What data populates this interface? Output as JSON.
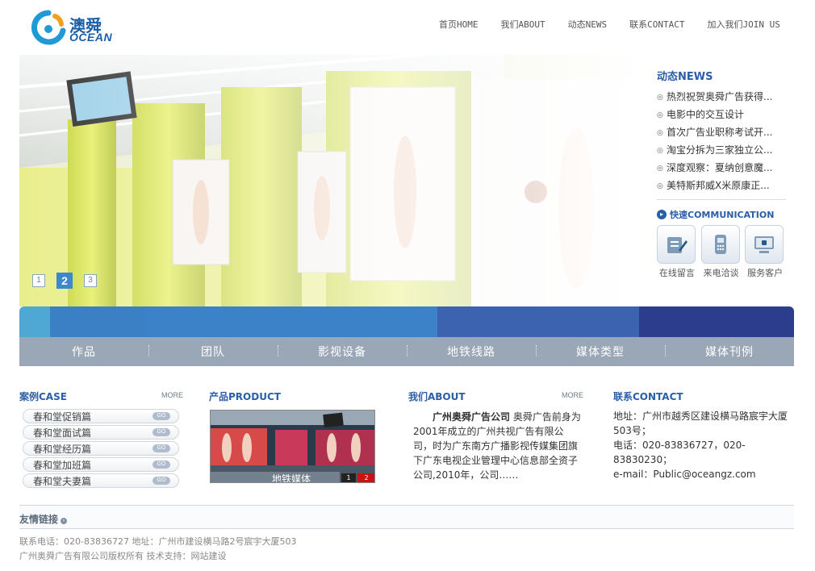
{
  "brand": {
    "logo_cn": "澳舜",
    "logo_en": "OCEAN"
  },
  "nav": {
    "items": [
      {
        "label": "首页HOME"
      },
      {
        "label": "我们ABOUT"
      },
      {
        "label": "动态NEWS"
      },
      {
        "label": "联系CONTACT"
      },
      {
        "label": "加入我们JOIN US"
      }
    ]
  },
  "banner": {
    "dots": [
      "1",
      "2",
      "3"
    ],
    "active_dot": "2",
    "icon": "subway-billboard-photo"
  },
  "news": {
    "title": "动态NEWS",
    "items": [
      "热烈祝贺奥舜广告获得...",
      "电影中的交互设计",
      "首次广告业职称考试开...",
      "淘宝分拆为三家独立公...",
      "深度观察：夏纳创意魔...",
      "美特斯邦威X米原康正..."
    ]
  },
  "quick": {
    "title": "快速COMMUNICATION",
    "items": [
      {
        "label": "在线留言",
        "icon": "message-icon"
      },
      {
        "label": "来电洽谈",
        "icon": "phone-icon"
      },
      {
        "label": "服务客户",
        "icon": "computer-icon"
      }
    ]
  },
  "strip_colors": [
    "#4fa7d4",
    "#3b7fc4",
    "#3b82c8",
    "#3c63b0",
    "#2c3d8e"
  ],
  "categories": [
    "作品",
    "团队",
    "影视设备",
    "地铁线路",
    "媒体类型",
    "媒体刊例"
  ],
  "cases": {
    "title": "案例CASE",
    "more": "MORE",
    "go": "GO",
    "items": [
      "春和堂促销篇",
      "春和堂面试篇",
      "春和堂经历篇",
      "春和堂加班篇",
      "春和堂夫妻篇"
    ]
  },
  "product": {
    "title": "产品PRODUCT",
    "caption": "地铁媒体",
    "pages": [
      "1",
      "2"
    ]
  },
  "about": {
    "title": "我们ABOUT",
    "more": "MORE",
    "company": "广州奥舜广告公司",
    "text": "奥舜广告前身为2001年成立的广州共视广告有限公司，时为广东南方广播影视传媒集团旗下广东电视企业管理中心信息部全资子公司,2010年，公司……"
  },
  "contact": {
    "title": "联系CONTACT",
    "address": "地址：广州市越秀区建设横马路宸宇大厦503号；",
    "phone": "电话：020-83836727，020-83830230；",
    "email": "e-mail：Public@oceangz.com"
  },
  "links": {
    "label": "友情链接"
  },
  "footer": {
    "line1": "联系电话：020-83836727 地址：广州市建设横马路2号宸宇大厦503",
    "line2": "广州奥舜广告有限公司版权所有 技术支持：网站建设"
  }
}
